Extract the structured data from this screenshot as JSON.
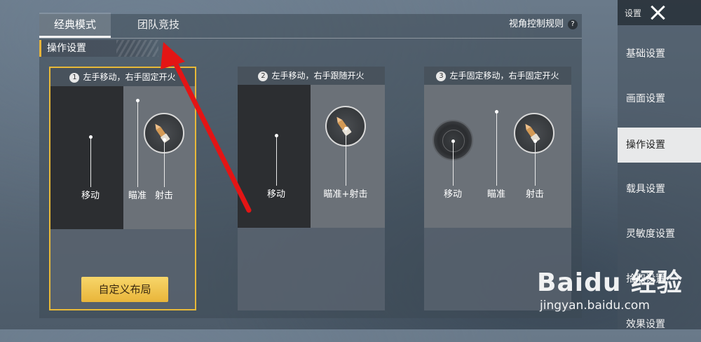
{
  "tabs": {
    "classic": "经典模式",
    "team": "团队竞技",
    "rules": "视角控制规则",
    "help": "?"
  },
  "section_title": "操作设置",
  "cards": [
    {
      "num": "1",
      "title": "左手移动，右手固定开火",
      "labels": {
        "move": "移动",
        "aim": "瞄准",
        "shoot": "射击"
      },
      "selected": true
    },
    {
      "num": "2",
      "title": "左手移动，右手跟随开火",
      "labels": {
        "move": "移动",
        "aim_shoot": "瞄准+射击"
      },
      "selected": false
    },
    {
      "num": "3",
      "title": "左手固定移动，右手固定开火",
      "labels": {
        "move": "移动",
        "aim": "瞄准",
        "shoot": "射击"
      },
      "selected": false
    }
  ],
  "custom_button": "自定义布局",
  "sidebar": {
    "title": "设置",
    "items": [
      {
        "label": "基础设置",
        "active": false
      },
      {
        "label": "画面设置",
        "active": false
      },
      {
        "label": "操作设置",
        "active": true
      },
      {
        "label": "载具设置",
        "active": false
      },
      {
        "label": "灵敏度设置",
        "active": false
      },
      {
        "label": "拾取设置",
        "active": false
      },
      {
        "label": "效果设置",
        "active": false
      }
    ]
  },
  "watermark": {
    "main": "Baidu 经验",
    "url": "jingyan.baidu.com"
  },
  "colors": {
    "accent": "#e8b938",
    "annotation_arrow": "#e31515"
  }
}
